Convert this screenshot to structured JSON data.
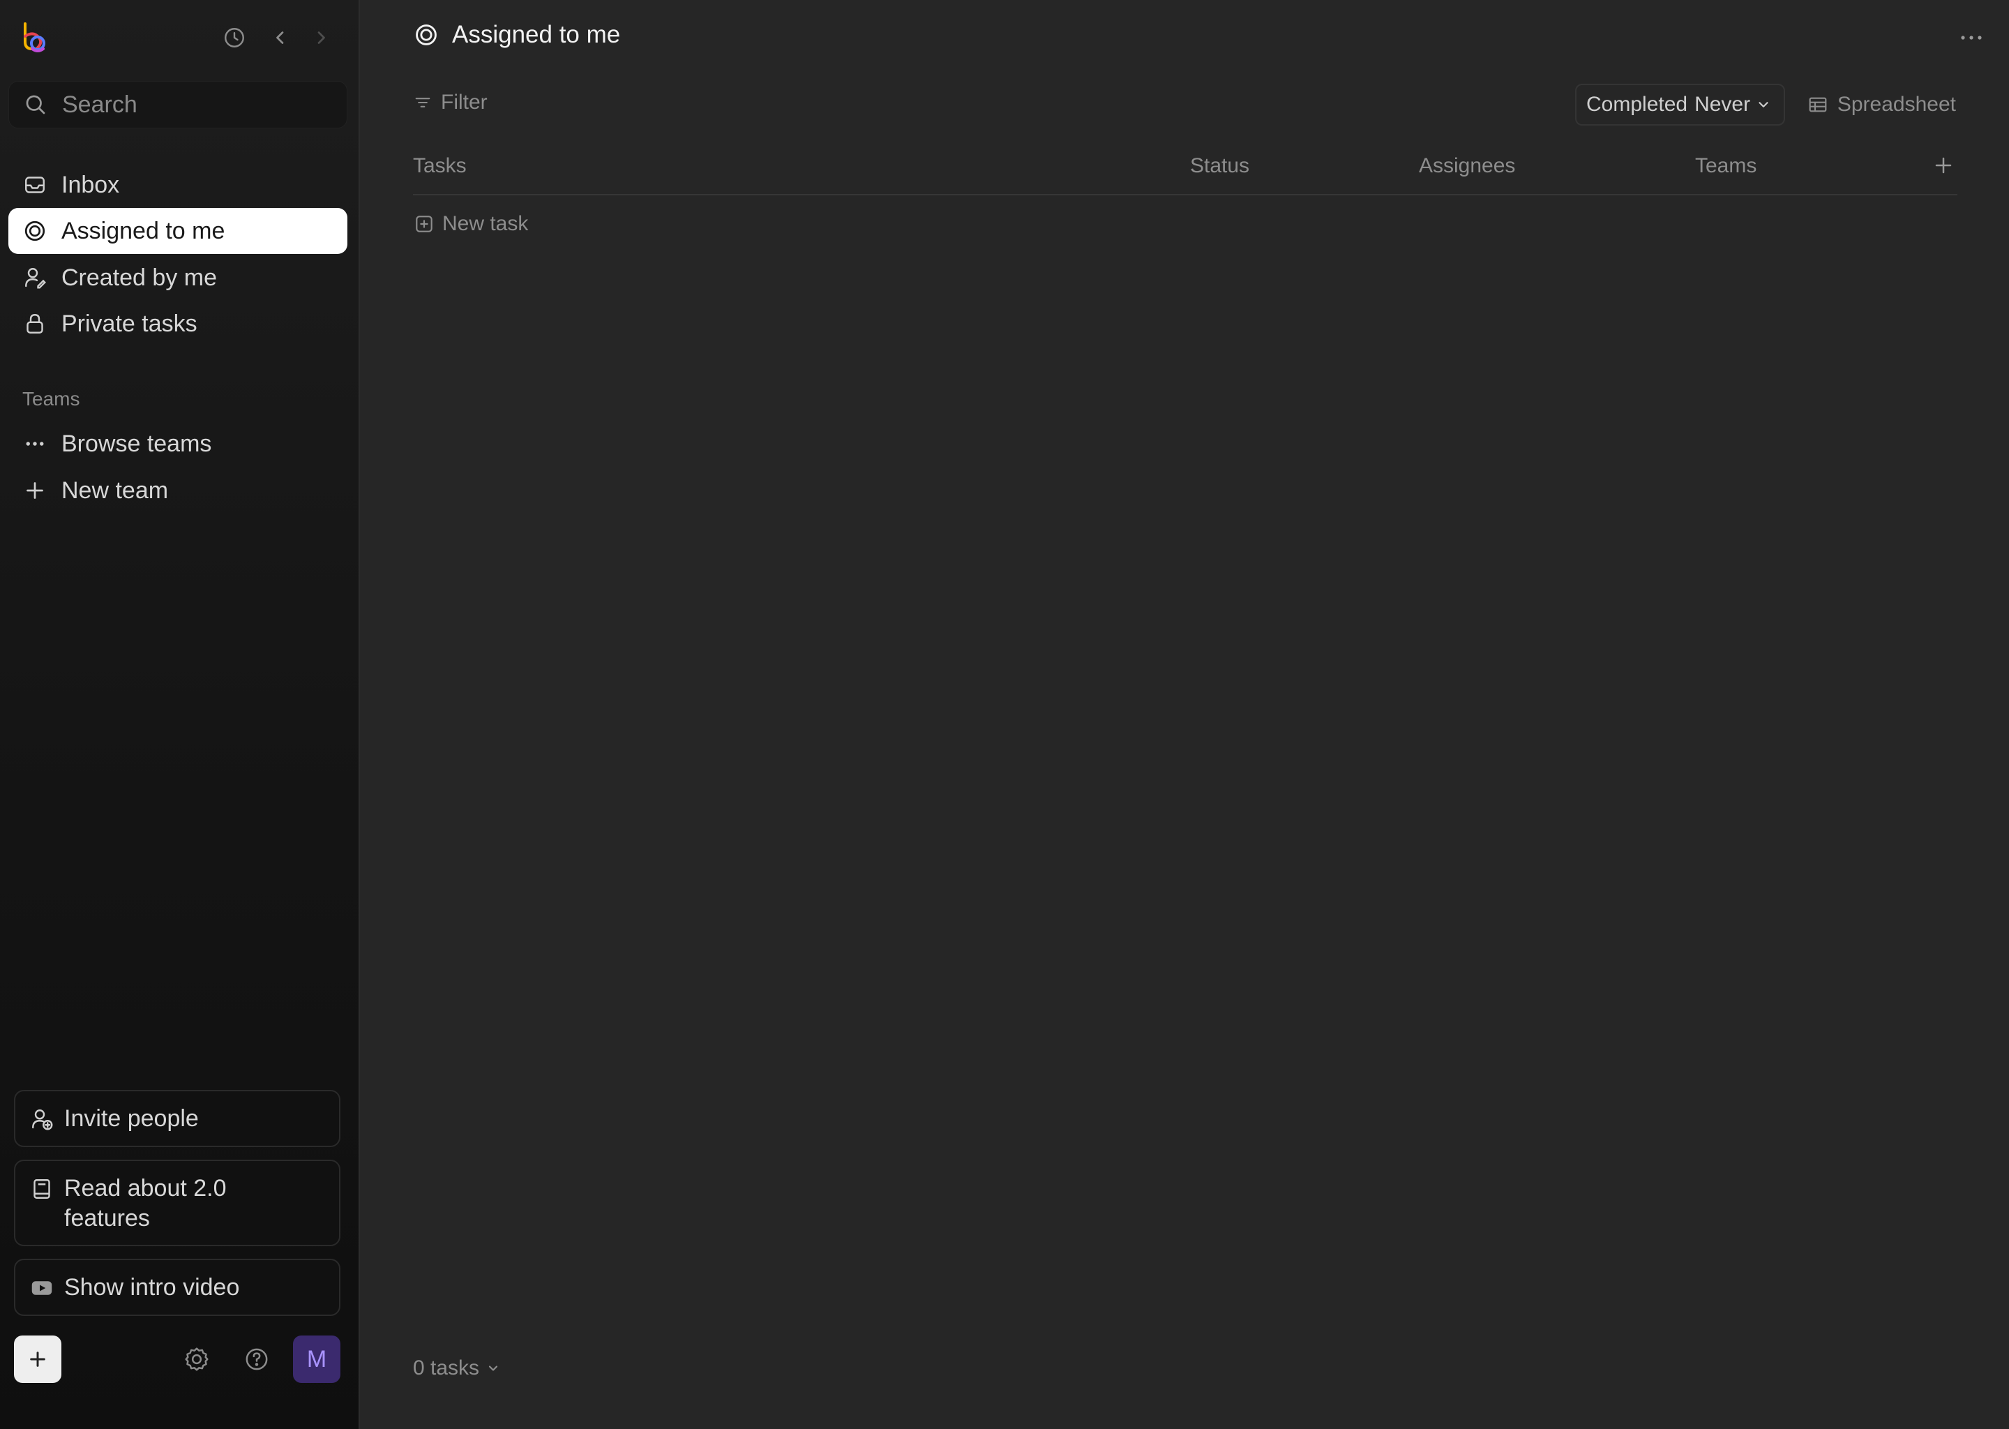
{
  "sidebar": {
    "search_placeholder": "Search",
    "nav": [
      {
        "label": "Inbox"
      },
      {
        "label": "Assigned to me"
      },
      {
        "label": "Created by me"
      },
      {
        "label": "Private tasks"
      }
    ],
    "teams_section_label": "Teams",
    "teams_items": [
      {
        "label": "Browse teams"
      },
      {
        "label": "New team"
      }
    ],
    "invite_label": "Invite people",
    "read_about_label": "Read about 2.0 features",
    "intro_video_label": "Show intro video",
    "avatar_initial": "M"
  },
  "main": {
    "title": "Assigned to me",
    "filter_label": "Filter",
    "completed_label": "Completed",
    "completed_value": "Never",
    "spreadsheet_label": "Spreadsheet",
    "columns": [
      "Tasks",
      "Status",
      "Assignees",
      "Teams"
    ],
    "new_task_label": "New task",
    "task_count_label": "0 tasks"
  },
  "colors": {
    "sidebar_bg": "#151515",
    "main_bg": "#262626",
    "active_item_bg": "#ffffff",
    "avatar_bg": "#3b2a6e",
    "avatar_fg": "#a993ff"
  }
}
